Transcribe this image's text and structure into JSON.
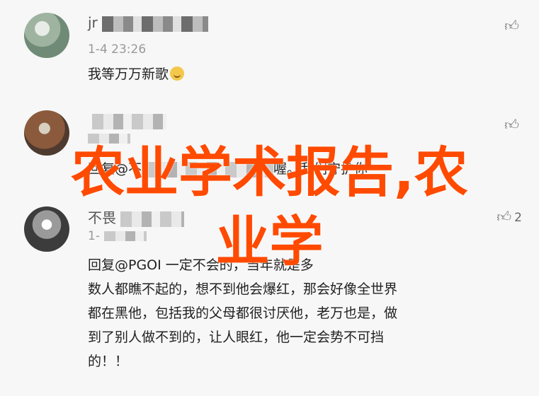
{
  "comments": [
    {
      "user": "jr",
      "time": "1-4 23:26",
      "text": "我等万万新歌",
      "like_count": ""
    },
    {
      "user": "",
      "time": "",
      "reply_prefix": "回复@不",
      "reply_suffix": "喔。我们守护你",
      "like_count": ""
    },
    {
      "user": "不畏",
      "time": "1-",
      "like_count": "2",
      "lines": [
        "回复@PGOI          一定不会的，当年就是多",
        "数人都瞧不起的，想不到他会爆红，那会好像全世界",
        "都在黑他，包括我的父母都很讨厌他，老万也是，做",
        "到了别人做不到的，让人眼红，他一定会势不可挡",
        "的！！"
      ]
    }
  ],
  "overlay": {
    "line1": "农业学术报告,农",
    "line2": "业学"
  },
  "icons": {
    "like": "thumbs-up-icon",
    "emoji": "smile-emoji-icon"
  },
  "colors": {
    "overlay": "#ff4a00",
    "background": "#f7f7f7"
  }
}
